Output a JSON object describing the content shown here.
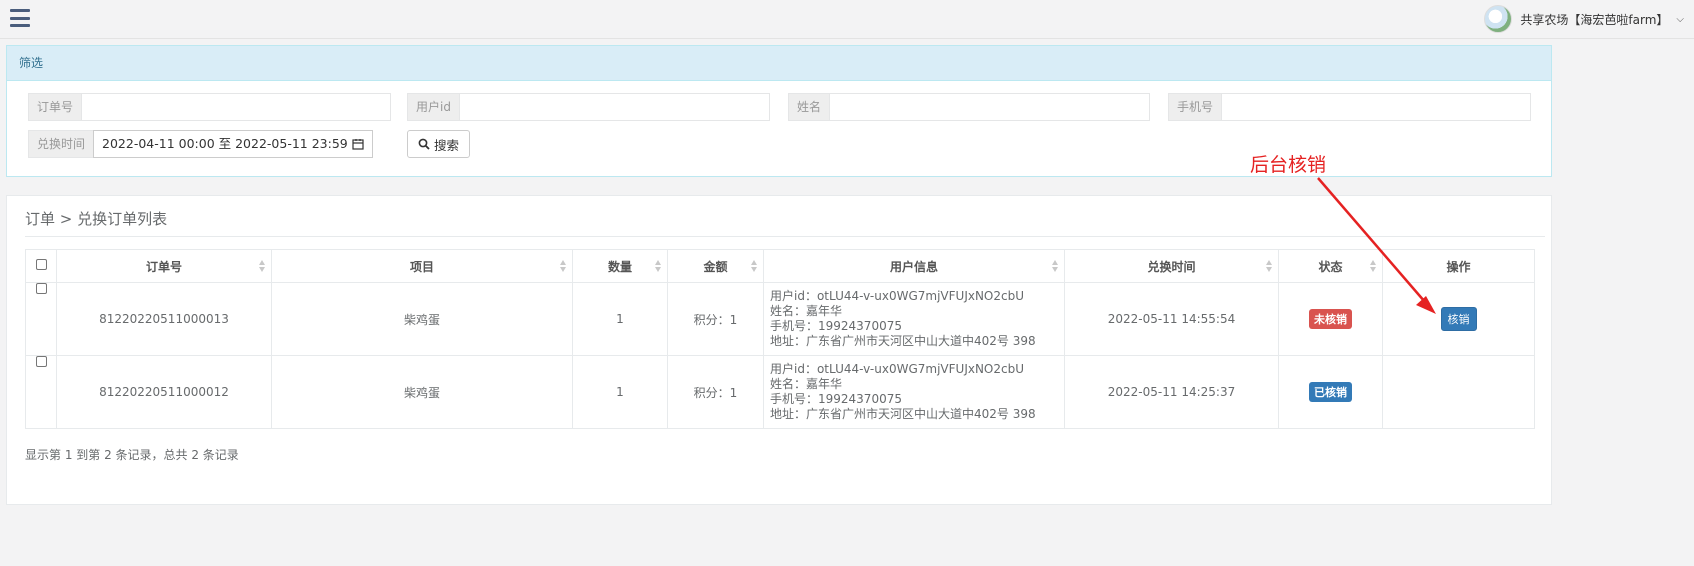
{
  "header": {
    "user_name": "共享农场【海宏芭啦farm】",
    "caret": "⌵"
  },
  "filter": {
    "title": "筛选",
    "fields": [
      {
        "label": "订单号",
        "value": ""
      },
      {
        "label": "用户id",
        "value": ""
      },
      {
        "label": "姓名",
        "value": ""
      },
      {
        "label": "手机号",
        "value": ""
      }
    ],
    "time_label": "兑换时间",
    "time_range": "2022-04-11 00:00 至 2022-05-11 23:59",
    "search_label": "搜索"
  },
  "main": {
    "breadcrumb": "订单 > 兑换订单列表",
    "columns": [
      "订单号",
      "项目",
      "数量",
      "金额",
      "用户信息",
      "兑换时间",
      "状态",
      "操作"
    ],
    "rows": [
      {
        "order_no": "81220220511000013",
        "item": "柴鸡蛋",
        "qty": "1",
        "amount": "积分：1",
        "user_id": "用户id：otLU44-v-ux0WG7mjVFUJxNO2cbU",
        "name": "姓名：嘉年华",
        "phone": "手机号：19924370075",
        "address": "地址：广东省广州市天河区中山大道中402号 398",
        "time": "2022-05-11 14:55:54",
        "status": "未核销",
        "action": "核销"
      },
      {
        "order_no": "81220220511000012",
        "item": "柴鸡蛋",
        "qty": "1",
        "amount": "积分：1",
        "user_id": "用户id：otLU44-v-ux0WG7mjVFUJxNO2cbU",
        "name": "姓名：嘉年华",
        "phone": "手机号：19924370075",
        "address": "地址：广东省广州市天河区中山大道中402号 398",
        "time": "2022-05-11 14:25:37",
        "status": "已核销",
        "action": ""
      }
    ],
    "footer": "显示第 1 到第 2 条记录，总共 2 条记录"
  },
  "annotation": {
    "text": "后台核销",
    "color": "#e52222"
  },
  "colors": {
    "status_pending": "#d9534f",
    "status_done": "#337ab7",
    "panel_heading": "#d9edf7"
  }
}
